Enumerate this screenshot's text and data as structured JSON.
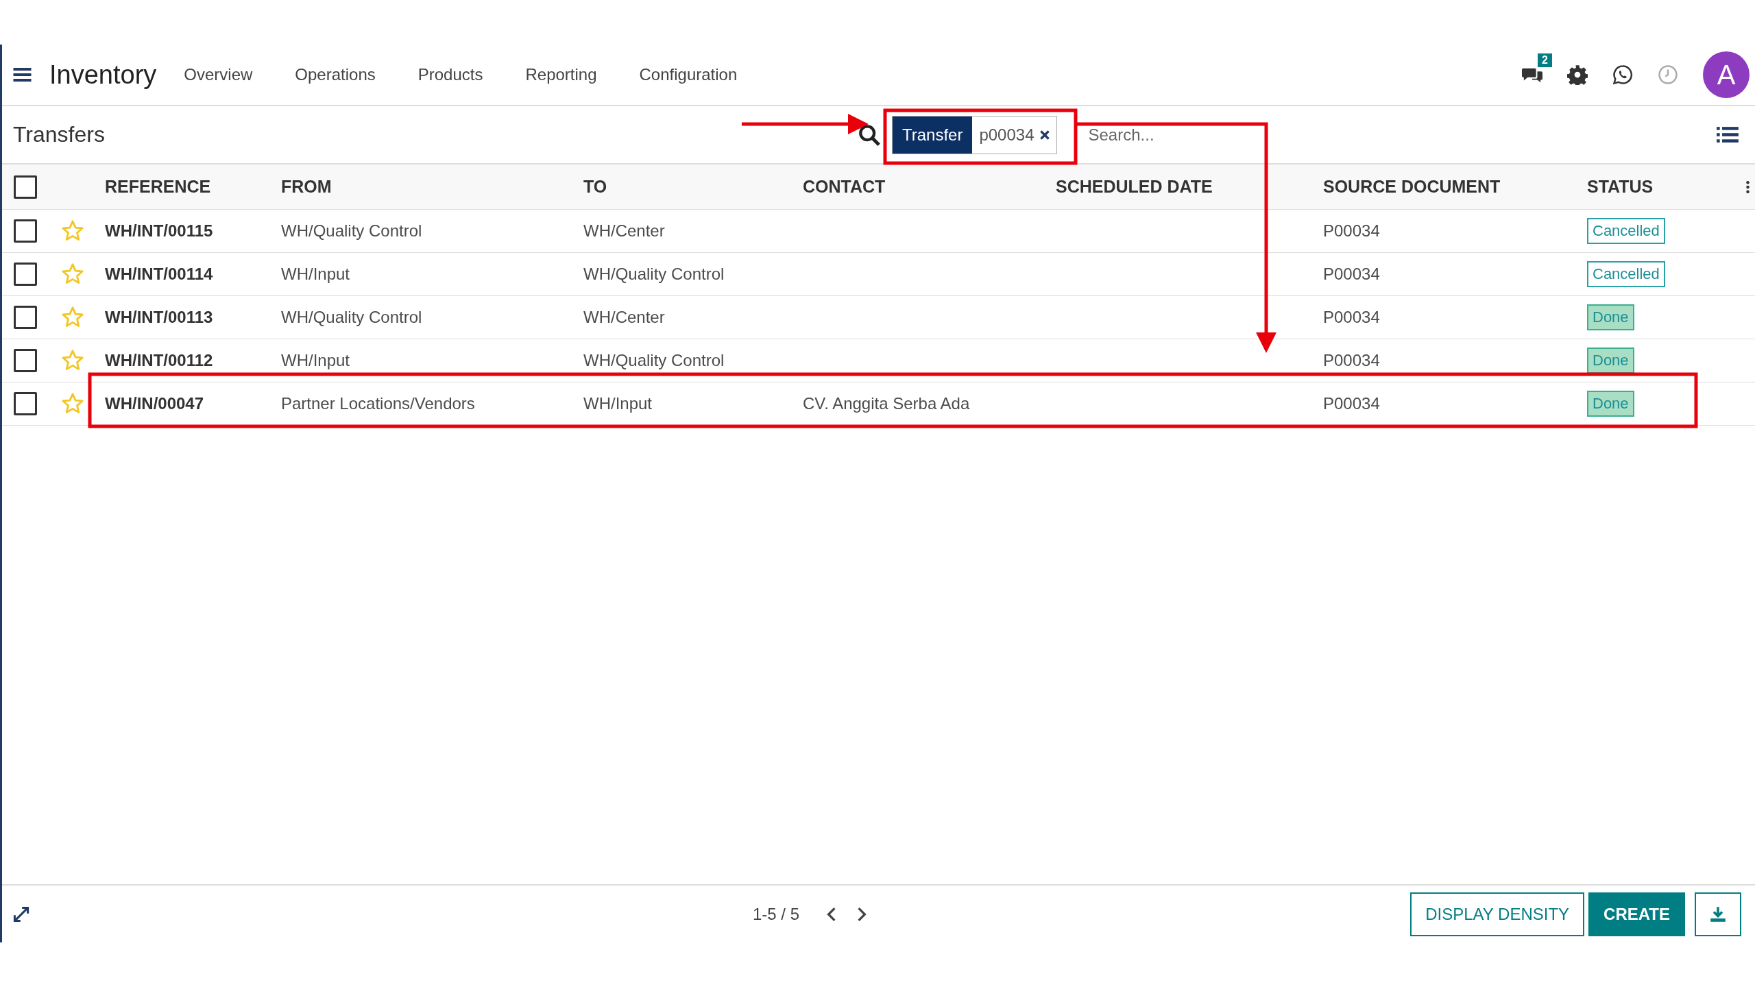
{
  "app": {
    "title": "Inventory",
    "menu": [
      "Overview",
      "Operations",
      "Products",
      "Reporting",
      "Configuration"
    ]
  },
  "systray": {
    "messages_badge": "2",
    "avatar": "A"
  },
  "control_panel": {
    "title": "Transfers",
    "facet": {
      "label": "Transfer",
      "value": "p00034"
    },
    "search": {
      "placeholder": "Search..."
    }
  },
  "table": {
    "all_checked": false,
    "columns": [
      "REFERENCE",
      "FROM",
      "TO",
      "CONTACT",
      "SCHEDULED DATE",
      "SOURCE DOCUMENT",
      "STATUS"
    ],
    "rows": [
      {
        "checked": false,
        "starred": false,
        "reference": "WH/INT/00115",
        "from": "WH/Quality Control",
        "to": "WH/Center",
        "contact": "",
        "source_document": "P00034",
        "status": {
          "label": "Cancelled",
          "kind": "cancelled"
        }
      },
      {
        "checked": false,
        "starred": false,
        "reference": "WH/INT/00114",
        "from": "WH/Input",
        "to": "WH/Quality Control",
        "contact": "",
        "source_document": "P00034",
        "status": {
          "label": "Cancelled",
          "kind": "cancelled"
        }
      },
      {
        "checked": false,
        "starred": false,
        "reference": "WH/INT/00113",
        "from": "WH/Quality Control",
        "to": "WH/Center",
        "contact": "",
        "source_document": "P00034",
        "status": {
          "label": "Done",
          "kind": "done"
        }
      },
      {
        "checked": false,
        "starred": false,
        "reference": "WH/INT/00112",
        "from": "WH/Input",
        "to": "WH/Quality Control",
        "contact": "",
        "source_document": "P00034",
        "status": {
          "label": "Done",
          "kind": "done"
        }
      },
      {
        "checked": false,
        "starred": false,
        "reference": "WH/IN/00047",
        "from": "Partner Locations/Vendors",
        "to": "WH/Input",
        "contact": "CV. Anggita Serba Ada",
        "source_document": "P00034",
        "status": {
          "label": "Done",
          "kind": "done"
        }
      }
    ]
  },
  "pager": {
    "range": "1-5 / 5"
  },
  "buttons": [
    {
      "label": "DISPLAY DENSITY",
      "kind": "secondary"
    },
    {
      "label": "CREATE",
      "kind": "primary"
    }
  ]
}
